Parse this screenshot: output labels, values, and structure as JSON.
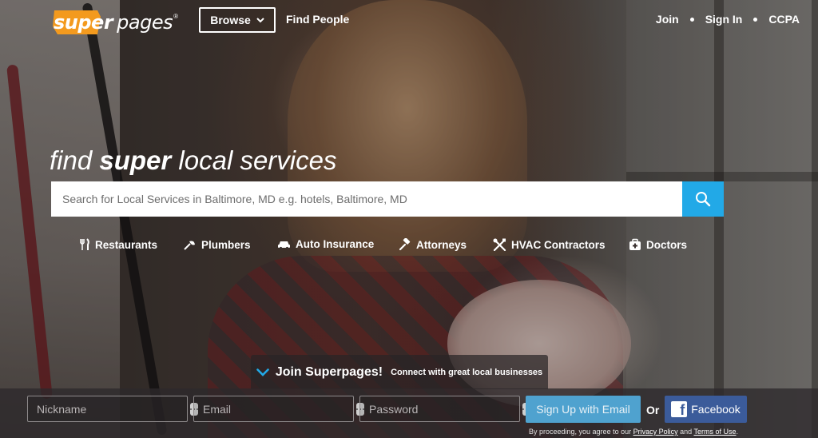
{
  "header": {
    "logo": {
      "super": "super",
      "pages": "pages",
      "reg": "®"
    },
    "browse_label": "Browse",
    "find_people_label": "Find People",
    "links": {
      "join": "Join",
      "sign_in": "Sign In",
      "ccpa": "CCPA"
    }
  },
  "hero": {
    "tagline": {
      "pre": "find ",
      "bold": "super",
      "post": " local services"
    },
    "search": {
      "placeholder": "Search for Local Services in Baltimore, MD e.g. hotels, Baltimore, MD",
      "value": "",
      "button_icon": "search-icon"
    },
    "categories": [
      {
        "label": "Restaurants",
        "icon": "fork-knife-icon"
      },
      {
        "label": "Plumbers",
        "icon": "plunger-icon"
      },
      {
        "label": "Auto Insurance",
        "icon": "car-icon"
      },
      {
        "label": "Attorneys",
        "icon": "gavel-icon"
      },
      {
        "label": "HVAC Contractors",
        "icon": "tools-icon"
      },
      {
        "label": "Doctors",
        "icon": "medical-bag-icon"
      }
    ]
  },
  "join": {
    "title": "Join Superpages!",
    "subtitle": "Connect with great local businesses",
    "fields": {
      "nickname_placeholder": "Nickname",
      "email_placeholder": "Email",
      "password_placeholder": "Password"
    },
    "signup_label": "Sign Up with Email",
    "or_label": "Or",
    "facebook_label": "Facebook",
    "legal": {
      "prefix": "By proceeding, you agree to our ",
      "privacy": "Privacy Policy",
      "and": " and ",
      "terms": "Terms of Use",
      "suffix": "."
    }
  },
  "colors": {
    "accent_blue": "#22a9e7",
    "logo_orange": "#f39a1e",
    "signup_blue": "#4fa2cf",
    "facebook_blue": "#3b5b9a"
  }
}
